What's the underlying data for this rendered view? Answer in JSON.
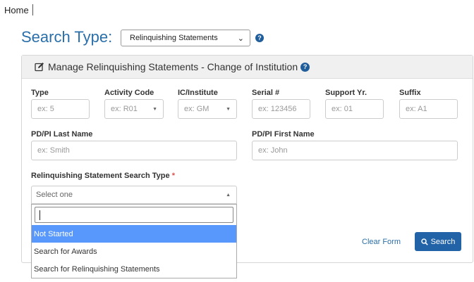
{
  "breadcrumb": {
    "home": "Home"
  },
  "search_type": {
    "label": "Search Type:",
    "selected": "Relinquishing Statements"
  },
  "panel": {
    "title": "Manage Relinquishing Statements - Change of Institution"
  },
  "fields": {
    "type": {
      "label": "Type",
      "placeholder": "ex: 5"
    },
    "activity_code": {
      "label": "Activity Code",
      "placeholder": "ex: R01"
    },
    "ic_institute": {
      "label": "IC/Institute",
      "placeholder": "ex: GM"
    },
    "serial": {
      "label": "Serial #",
      "placeholder": "ex: 123456"
    },
    "support_yr": {
      "label": "Support Yr.",
      "placeholder": "ex: 01"
    },
    "suffix": {
      "label": "Suffix",
      "placeholder": "ex: A1"
    },
    "pdpi_last": {
      "label": "PD/PI Last Name",
      "placeholder": "ex: Smith"
    },
    "pdpi_first": {
      "label": "PD/PI First Name",
      "placeholder": "ex: John"
    },
    "stmt_search_type": {
      "label": "Relinquishing Statement Search Type",
      "required_mark": "*",
      "placeholder": "Select one"
    }
  },
  "dropdown": {
    "search_value": "",
    "options": [
      "Not Started",
      "Search for Awards",
      "Search for Relinquishing Statements"
    ],
    "highlighted_index": 0
  },
  "actions": {
    "clear": "Clear Form",
    "search": "Search"
  },
  "colors": {
    "accent": "#2263a8",
    "highlight": "#5897fb",
    "required": "#d9534f"
  }
}
